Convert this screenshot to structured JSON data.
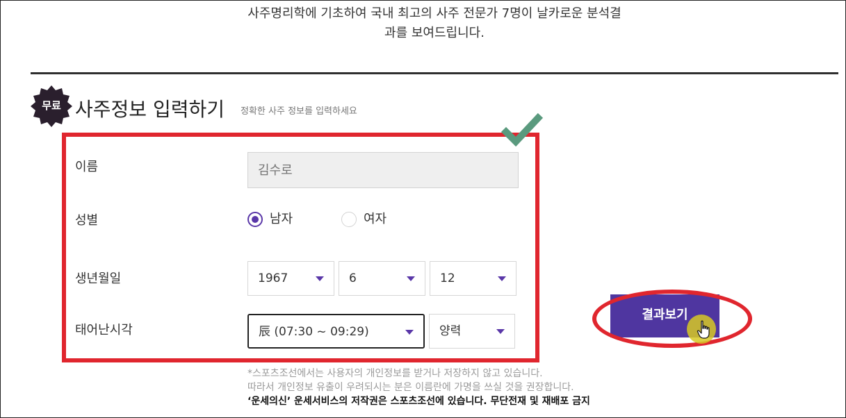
{
  "intro": {
    "line1": "사주명리학에 기초하여 국내 최고의 사주 전문가 7명이 날카로운 분석결",
    "line2": "과를 보여드립니다."
  },
  "section": {
    "badge": "무료",
    "title": "사주정보 입력하기",
    "subtitle": "정확한 사주 정보를 입력하세요"
  },
  "form": {
    "name_label": "이름",
    "name_placeholder": "김수로",
    "gender_label": "성별",
    "gender_options": [
      "남자",
      "여자"
    ],
    "gender_selected": "남자",
    "birth_label": "생년월일",
    "birth_year": "1967",
    "birth_month": "6",
    "birth_day": "12",
    "time_label": "태어난시각",
    "time_value": "辰 (07:30 ~ 09:29)",
    "calendar_value": "양력"
  },
  "actions": {
    "result_label": "결과보기"
  },
  "notices": {
    "line1": "*스포츠조선에서는 사용자의 개인정보를 받거나 저장하지 않고 있습니다.",
    "line2": "따라서 개인정보 유출이 우려되시는 분은 이름란에 가명을 쓰실 것을 권장합니다.",
    "line3": "‘운세의신’ 운세서비스의 저작권은 스포츠조선에 있습니다. 무단전재 및 재배포 금지"
  },
  "colors": {
    "accent": "#5a37a8",
    "button": "#4f36a0",
    "highlight": "#e0262e",
    "check": "#5a9a7e",
    "cursor_glow": "#d6c824"
  },
  "icons": {
    "badge": "scalloped-seal-icon",
    "check": "checkmark-icon",
    "cursor": "hand-pointer-icon",
    "dropdown": "caret-down-icon"
  }
}
